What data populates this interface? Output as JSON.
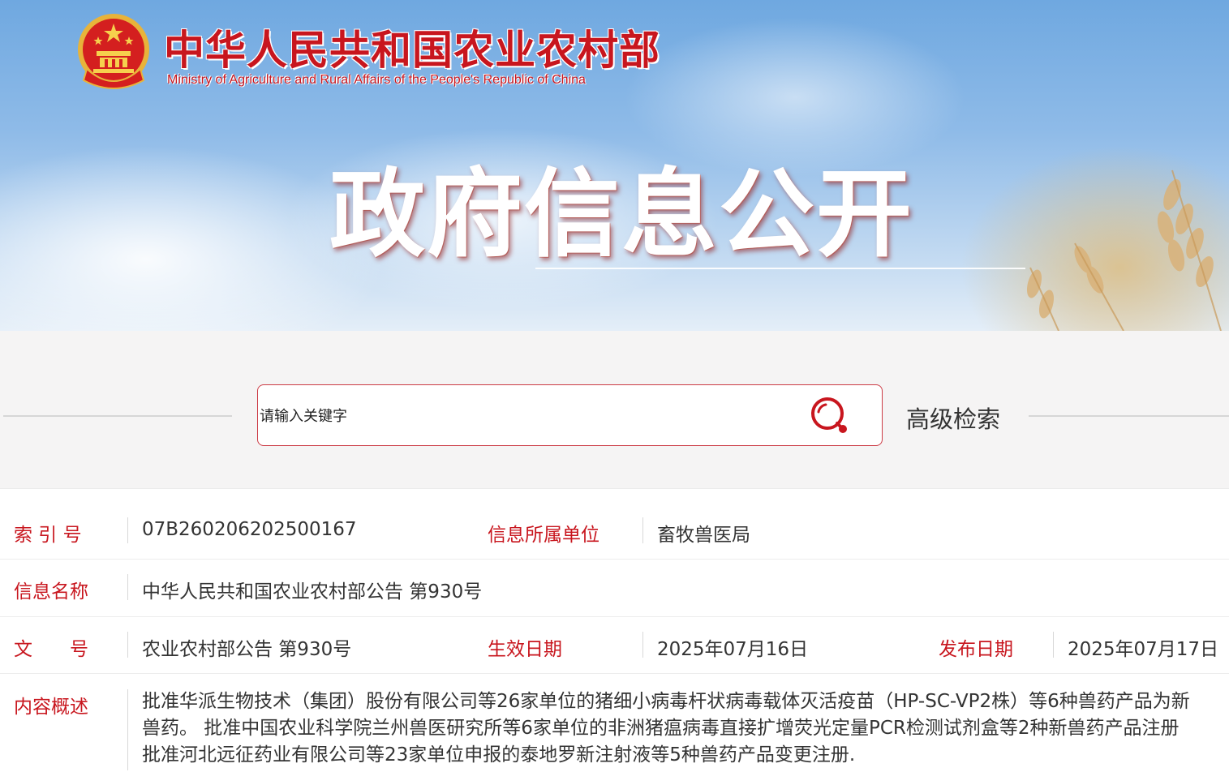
{
  "header": {
    "ministry_cn": "中华人民共和国农业农村部",
    "ministry_en": "Ministry of Agriculture and Rural Affairs of the People's Republic of China",
    "page_title": "政府信息公开"
  },
  "search": {
    "placeholder": "请输入关键字",
    "advanced_label": "高级检索"
  },
  "info": {
    "index_label": "索 引 号",
    "index_value": "07B260206202500167",
    "unit_label": "信息所属单位",
    "unit_value": "畜牧兽医局",
    "name_label": "信息名称",
    "name_value": "中华人民共和国农业农村部公告 第930号",
    "doc_label": "文　　号",
    "doc_value": "农业农村部公告 第930号",
    "effective_label": "生效日期",
    "effective_value": "2025年07月16日",
    "publish_label": "发布日期",
    "publish_value": "2025年07月17日",
    "summary_label": "内容概述",
    "summary_lines": [
      "批准华派生物技术（集团）股份有限公司等26家单位的猪细小病毒杆状病毒载体灭活疫苗（HP-SC-VP2株）等6种兽药产品为新",
      "兽药。 批准中国农业科学院兰州兽医研究所等6家单位的非洲猪瘟病毒直接扩增荧光定量PCR检测试剂盒等2种新兽药产品注册",
      "批准河北远征药业有限公司等23家单位申报的泰地罗新注射液等5种兽药产品变更注册."
    ]
  },
  "colors": {
    "brand_red": "#c8161e",
    "search_border": "#cc3b45"
  }
}
